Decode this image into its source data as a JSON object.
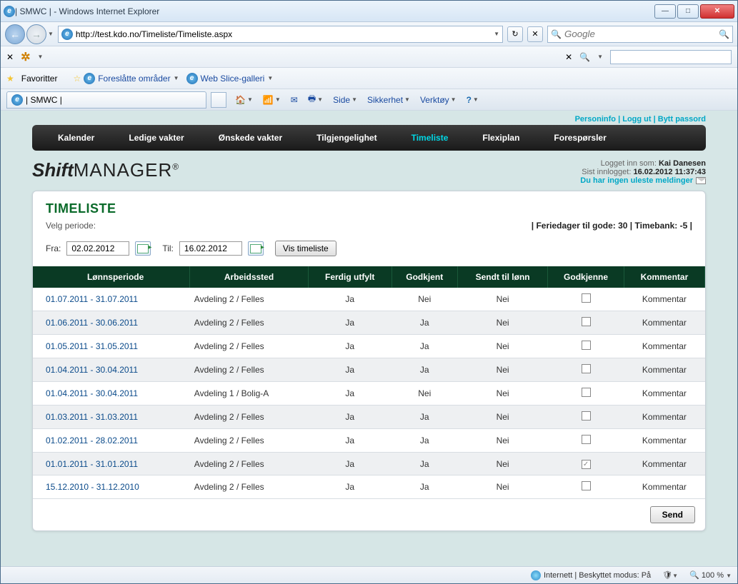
{
  "window": {
    "title": "| SMWC | - Windows Internet Explorer",
    "url": "http://test.kdo.no/Timeliste/Timeliste.aspx",
    "search_placeholder": "Google"
  },
  "ie_toolbar": {
    "favorites": "Favoritter",
    "suggested": "Foreslåtte områder",
    "webslice": "Web Slice-galleri",
    "tab_title": "| SMWC |",
    "side": "Side",
    "sikkerhet": "Sikkerhet",
    "verktoy": "Verktøy"
  },
  "top_links": {
    "personinfo": "Personinfo",
    "loggut": "Logg ut",
    "byttpassord": "Bytt passord"
  },
  "nav": {
    "items": [
      {
        "label": "Kalender",
        "active": false
      },
      {
        "label": "Ledige vakter",
        "active": false
      },
      {
        "label": "Ønskede vakter",
        "active": false
      },
      {
        "label": "Tilgjengelighet",
        "active": false
      },
      {
        "label": "Timeliste",
        "active": true
      },
      {
        "label": "Flexiplan",
        "active": false
      },
      {
        "label": "Forespørsler",
        "active": false
      }
    ]
  },
  "login": {
    "logged_in_as_label": "Logget inn som:",
    "logged_in_as": "Kai Danesen",
    "last_login_label": "Sist innlogget:",
    "last_login": "16.02.2012 11:37:43",
    "unread_msg": "Du har ingen uleste meldinger"
  },
  "panel": {
    "title": "TIMELISTE",
    "velg_periode": "Velg periode:",
    "summary": "| Feriedager til gode: 30 | Timebank: -5 |",
    "fra_label": "Fra:",
    "fra_value": "02.02.2012",
    "til_label": "Til:",
    "til_value": "16.02.2012",
    "vis_btn": "Vis timeliste",
    "send_btn": "Send"
  },
  "table": {
    "headers": [
      "Lønnsperiode",
      "Arbeidssted",
      "Ferdig utfylt",
      "Godkjent",
      "Sendt til lønn",
      "Godkjenne",
      "Kommentar"
    ],
    "rows": [
      {
        "period": "01.07.2011 - 31.07.2011",
        "sted": "Avdeling 2 / Felles",
        "ferdig": "Ja",
        "godkjent": "Nei",
        "sendt": "Nei",
        "approve": false,
        "kommentar": "Kommentar"
      },
      {
        "period": "01.06.2011 - 30.06.2011",
        "sted": "Avdeling 2 / Felles",
        "ferdig": "Ja",
        "godkjent": "Ja",
        "sendt": "Nei",
        "approve": false,
        "kommentar": "Kommentar"
      },
      {
        "period": "01.05.2011 - 31.05.2011",
        "sted": "Avdeling 2 / Felles",
        "ferdig": "Ja",
        "godkjent": "Ja",
        "sendt": "Nei",
        "approve": false,
        "kommentar": "Kommentar"
      },
      {
        "period": "01.04.2011 - 30.04.2011",
        "sted": "Avdeling 2 / Felles",
        "ferdig": "Ja",
        "godkjent": "Ja",
        "sendt": "Nei",
        "approve": false,
        "kommentar": "Kommentar"
      },
      {
        "period": "01.04.2011 - 30.04.2011",
        "sted": "Avdeling 1 / Bolig-A",
        "ferdig": "Ja",
        "godkjent": "Nei",
        "sendt": "Nei",
        "approve": false,
        "kommentar": "Kommentar"
      },
      {
        "period": "01.03.2011 - 31.03.2011",
        "sted": "Avdeling 2 / Felles",
        "ferdig": "Ja",
        "godkjent": "Ja",
        "sendt": "Nei",
        "approve": false,
        "kommentar": "Kommentar"
      },
      {
        "period": "01.02.2011 - 28.02.2011",
        "sted": "Avdeling 2 / Felles",
        "ferdig": "Ja",
        "godkjent": "Ja",
        "sendt": "Nei",
        "approve": false,
        "kommentar": "Kommentar"
      },
      {
        "period": "01.01.2011 - 31.01.2011",
        "sted": "Avdeling 2 / Felles",
        "ferdig": "Ja",
        "godkjent": "Ja",
        "sendt": "Nei",
        "approve": true,
        "kommentar": "Kommentar"
      },
      {
        "period": "15.12.2010 - 31.12.2010",
        "sted": "Avdeling 2 / Felles",
        "ferdig": "Ja",
        "godkjent": "Ja",
        "sendt": "Nei",
        "approve": false,
        "kommentar": "Kommentar"
      }
    ]
  },
  "statusbar": {
    "zone": "Internett | Beskyttet modus: På",
    "zoom": "100 %"
  }
}
